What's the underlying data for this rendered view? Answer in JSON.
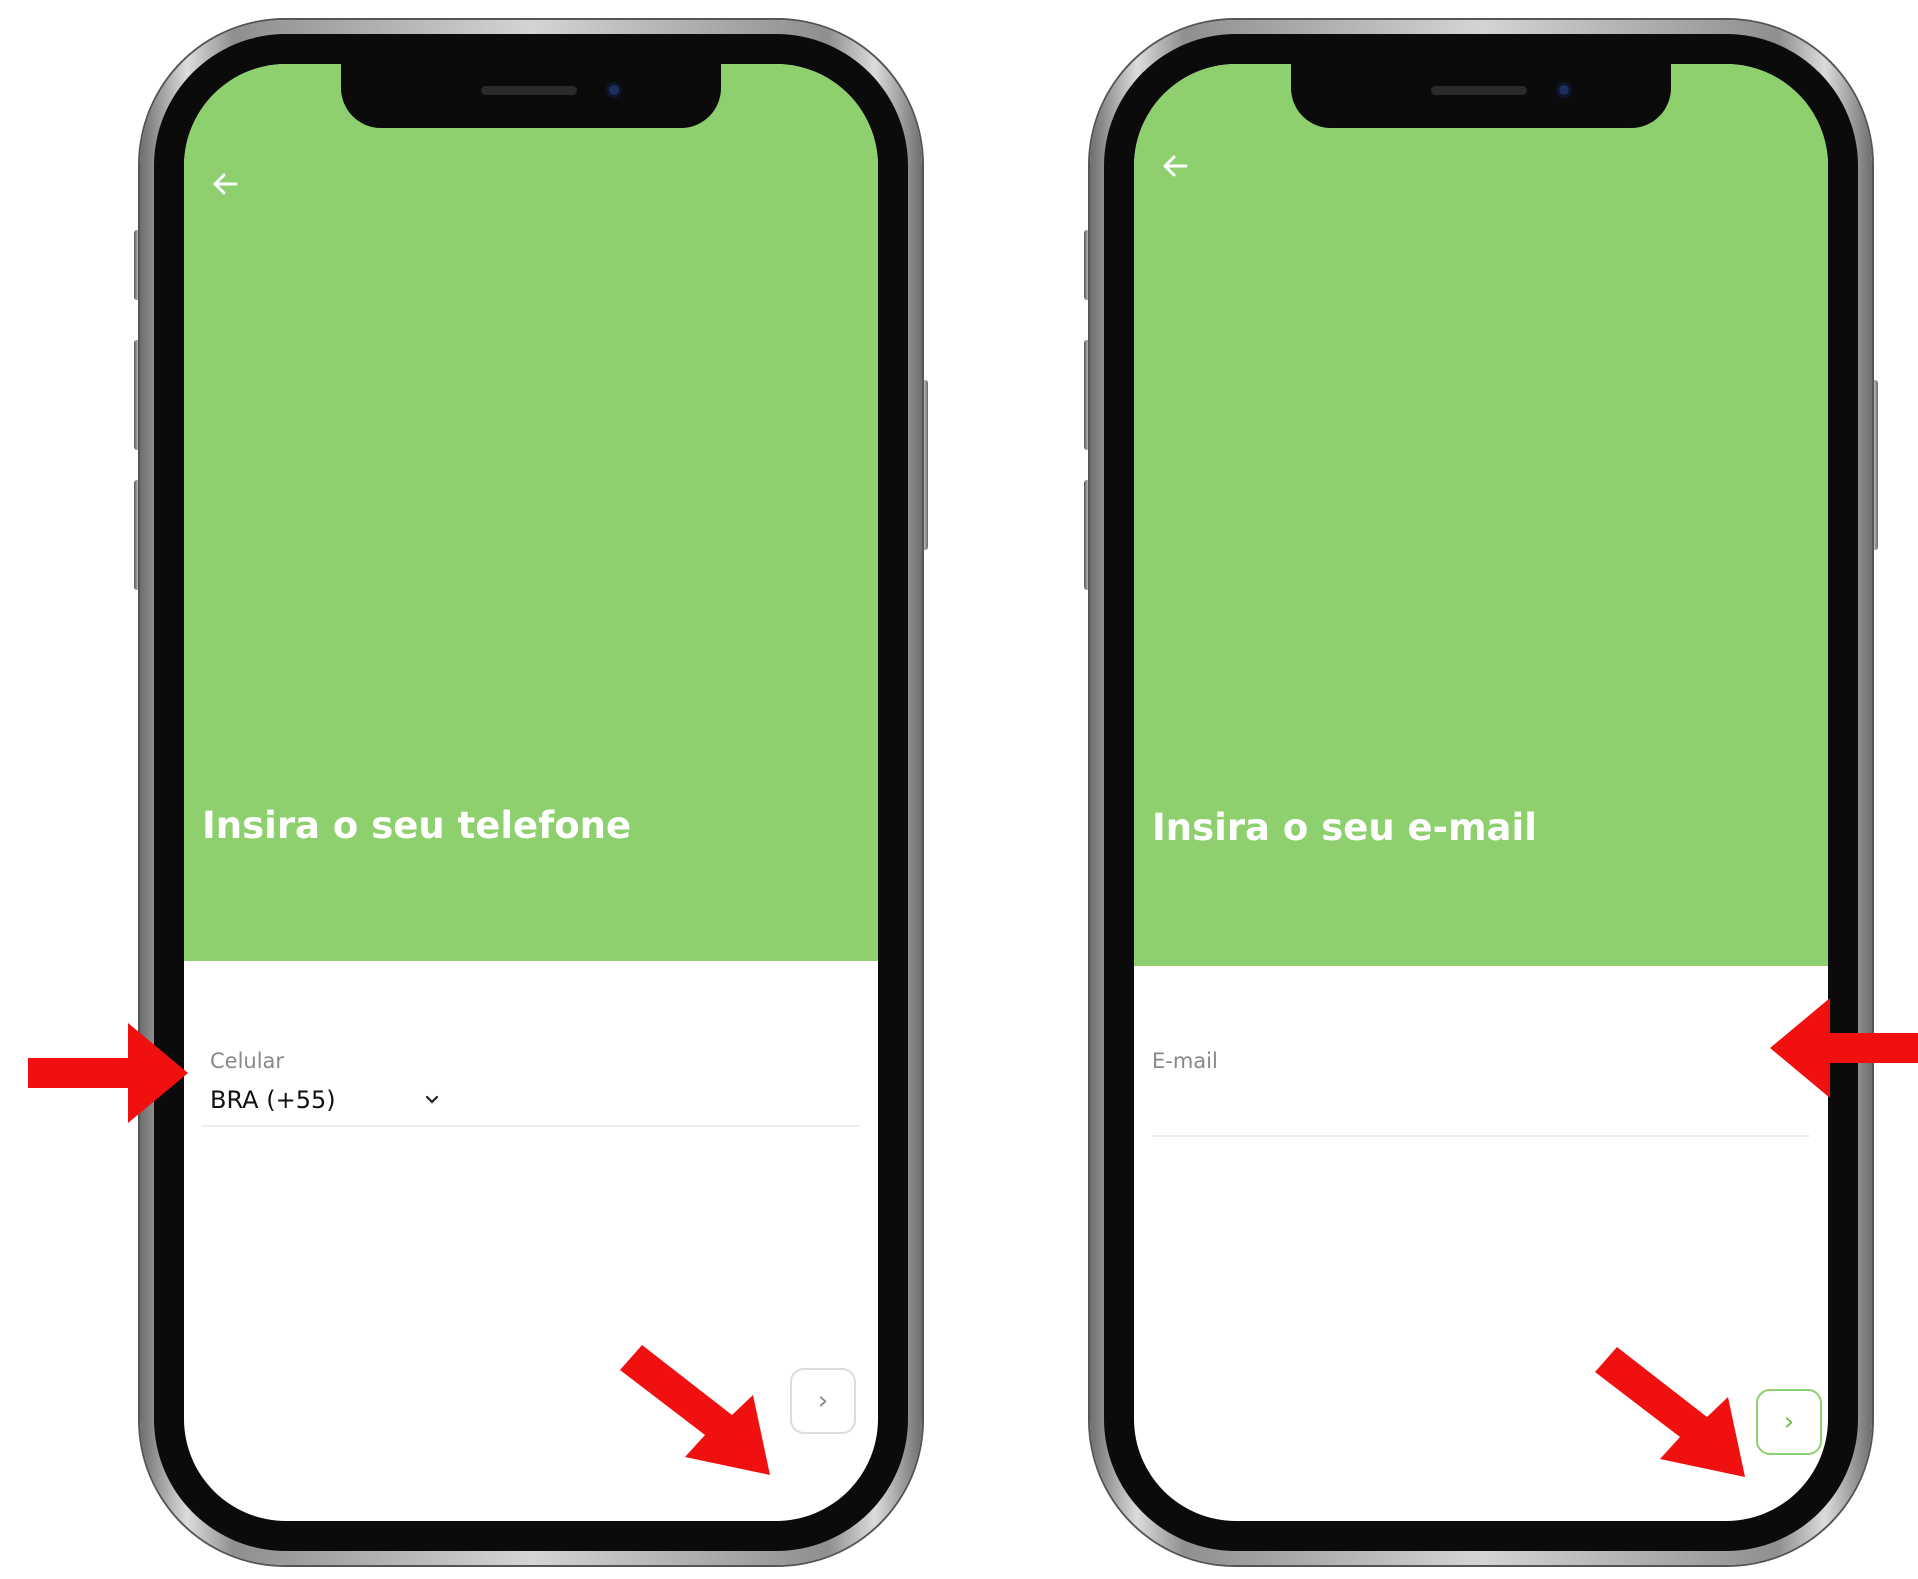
{
  "phone_screen": {
    "title": "Insira o seu telefone",
    "field_label": "Celular",
    "country_select": "BRA (+55)",
    "next_symbol": "›"
  },
  "email_screen": {
    "title": "Insira o seu e-mail",
    "field_label": "E-mail",
    "email_value": "",
    "next_symbol": "›"
  },
  "icons": [
    "arrow-left-icon",
    "chevron-down-icon",
    "chevron-right-icon",
    "annotation-arrow"
  ],
  "colors": {
    "hero_green": "#8ed06e",
    "annotation_red": "#f01010"
  }
}
